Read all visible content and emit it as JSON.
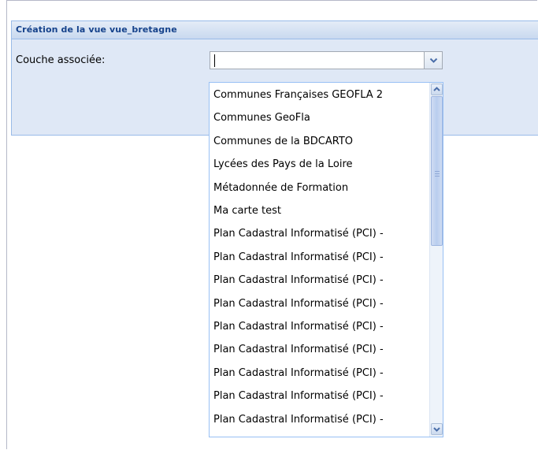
{
  "panel": {
    "title": "Création de la vue vue_bretagne"
  },
  "form": {
    "field_label": "Couche associée:",
    "input_value": ""
  },
  "dropdown": {
    "items": [
      "Communes Françaises GEOFLA 2",
      "Communes GeoFla",
      "Communes de la BDCARTO",
      "Lycées des Pays de la Loire",
      "Métadonnée de Formation",
      "Ma carte test",
      "Plan Cadastral Informatisé (PCI) -",
      "Plan Cadastral Informatisé (PCI) -",
      "Plan Cadastral Informatisé (PCI) -",
      "Plan Cadastral Informatisé (PCI) -",
      "Plan Cadastral Informatisé (PCI) -",
      "Plan Cadastral Informatisé (PCI) -",
      "Plan Cadastral Informatisé (PCI) -",
      "Plan Cadastral Informatisé (PCI) -",
      "Plan Cadastral Informatisé (PCI) -"
    ]
  },
  "icons": {
    "trigger": "chevron-down-icon",
    "scroll_up": "scroll-up-icon",
    "scroll_down": "scroll-down-icon"
  },
  "colors": {
    "panel_title": "#15428b",
    "panel_border": "#99bbe8",
    "list_border": "#98c0f4"
  }
}
